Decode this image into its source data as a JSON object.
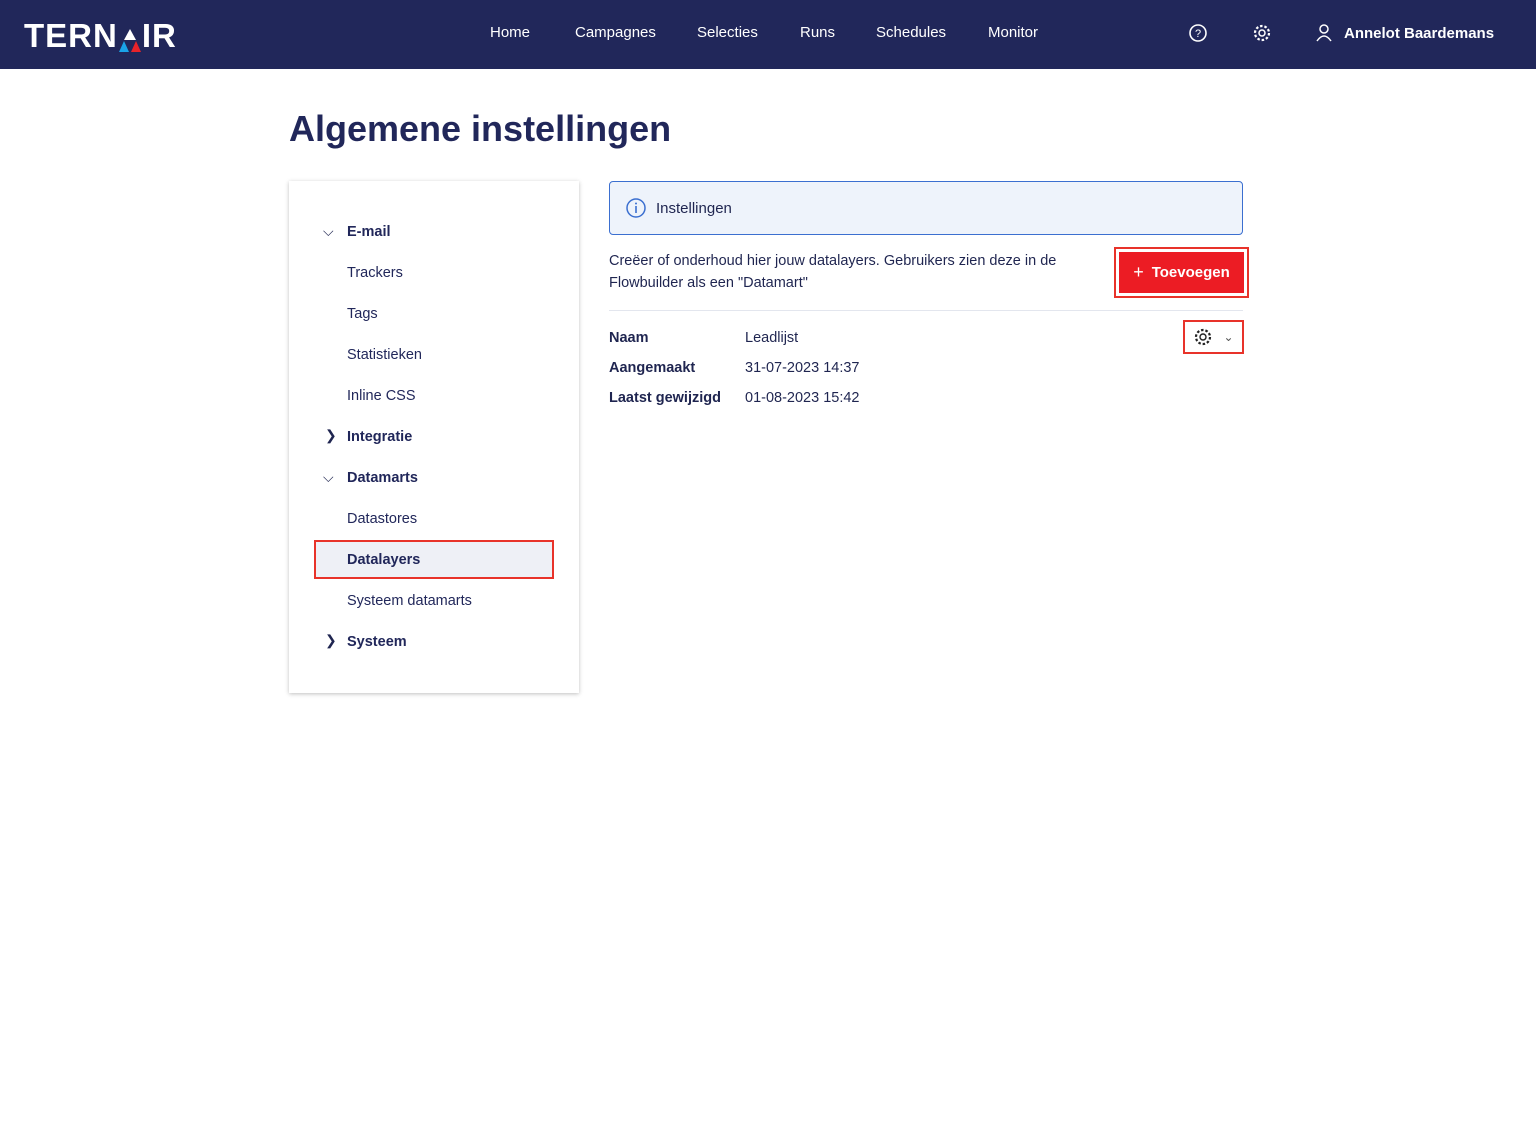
{
  "header": {
    "logo": "TERNAIR",
    "nav": [
      "Home",
      "Campagnes",
      "Selecties",
      "Runs",
      "Schedules",
      "Monitor"
    ],
    "user": "Annelot Baardemans"
  },
  "page_title": "Algemene instellingen",
  "sidebar": {
    "items": [
      {
        "label": "E-mail",
        "group": true,
        "open": true
      },
      {
        "label": "Trackers"
      },
      {
        "label": "Tags"
      },
      {
        "label": "Statistieken"
      },
      {
        "label": "Inline CSS"
      },
      {
        "label": "Integratie",
        "group": true,
        "open": false
      },
      {
        "label": "Datamarts",
        "group": true,
        "open": true
      },
      {
        "label": "Datastores"
      },
      {
        "label": "Datalayers",
        "selected": true
      },
      {
        "label": "Systeem datamarts"
      },
      {
        "label": "Systeem",
        "group": true,
        "open": false
      }
    ]
  },
  "main": {
    "info": "Instellingen",
    "description": "Creëer of onderhoud hier jouw datalayers. Gebruikers zien deze in de Flowbuilder als een \"Datamart\"",
    "add_label": "Toevoegen",
    "details": [
      {
        "key": "Naam",
        "value": "Leadlijst"
      },
      {
        "key": "Aangemaakt",
        "value": "31-07-2023 14:37"
      },
      {
        "key": "Laatst gewijzigd",
        "value": "01-08-2023 15:42"
      }
    ]
  }
}
